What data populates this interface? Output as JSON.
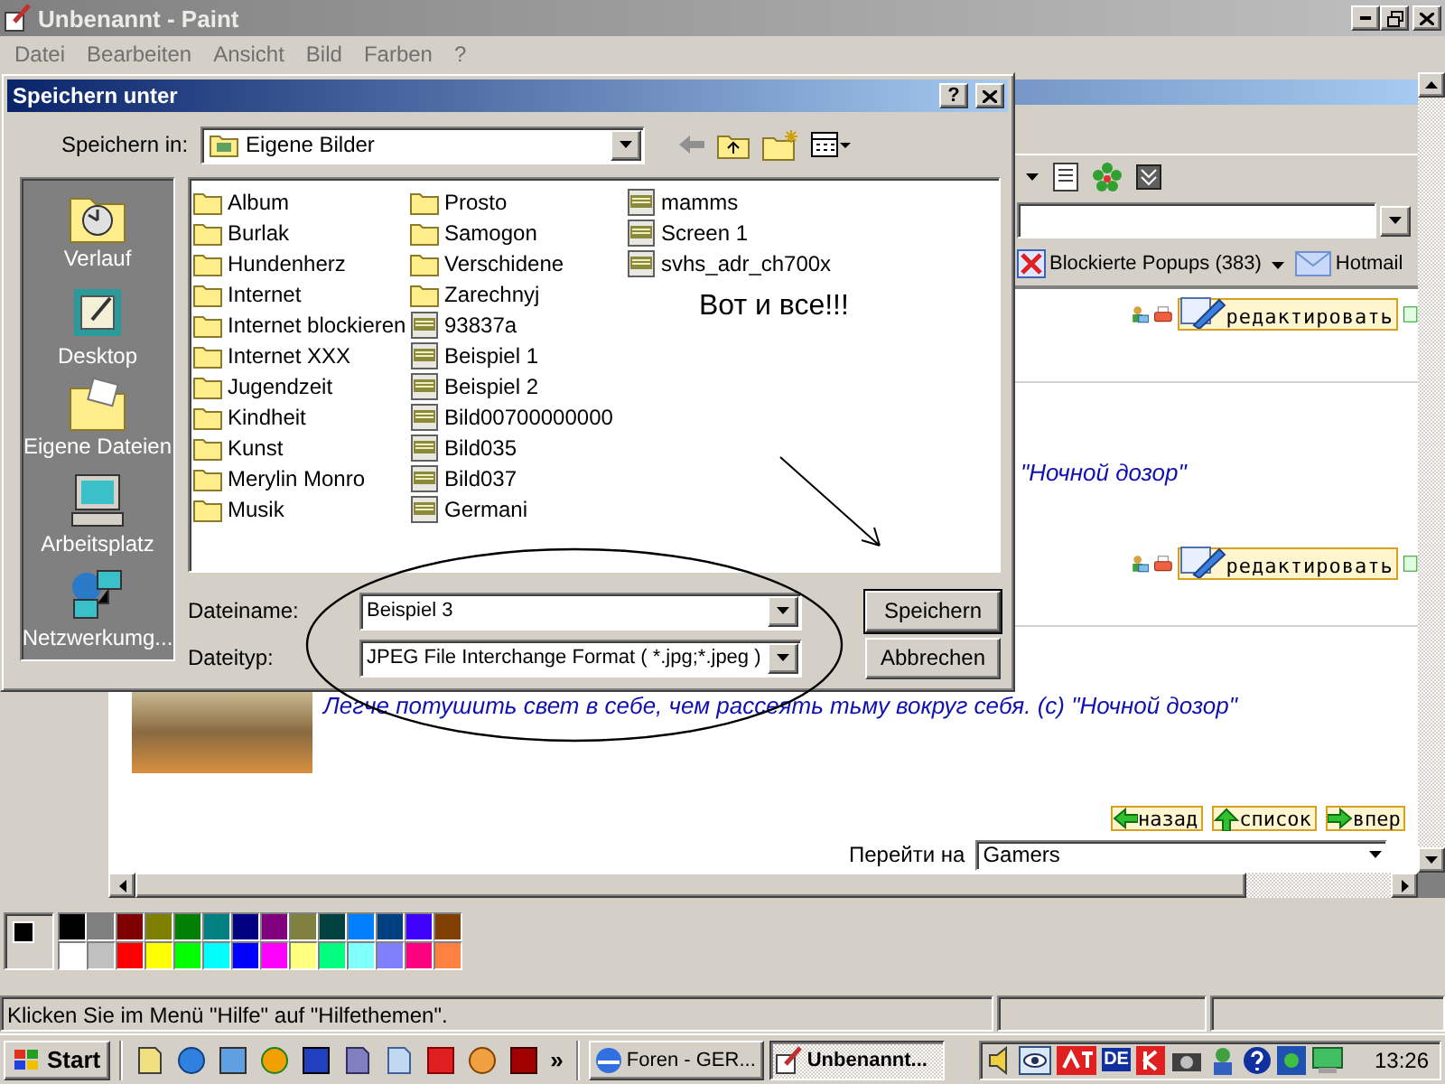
{
  "paint": {
    "title": "Unbenannt - Paint",
    "menu": [
      "Datei",
      "Bearbeiten",
      "Ansicht",
      "Bild",
      "Farben",
      "?"
    ]
  },
  "dialog": {
    "title": "Speichern unter",
    "help": "?",
    "save_in_label": "Speichern in:",
    "save_in_value": "Eigene Bilder",
    "places": [
      {
        "label": "Verlauf",
        "kind": "history"
      },
      {
        "label": "Desktop",
        "kind": "desktop"
      },
      {
        "label": "Eigene Dateien",
        "kind": "documents"
      },
      {
        "label": "Arbeitsplatz",
        "kind": "computer"
      },
      {
        "label": "Netzwerkumg...",
        "kind": "network"
      }
    ],
    "files": [
      {
        "name": "Album",
        "kind": "folder"
      },
      {
        "name": "Burlak",
        "kind": "folder"
      },
      {
        "name": "Hundenherz",
        "kind": "folder"
      },
      {
        "name": "Internet",
        "kind": "folder"
      },
      {
        "name": "Internet blockieren",
        "kind": "folder"
      },
      {
        "name": "Internet XXX",
        "kind": "folder"
      },
      {
        "name": "Jugendzeit",
        "kind": "folder"
      },
      {
        "name": "Kindheit",
        "kind": "folder"
      },
      {
        "name": "Kunst",
        "kind": "folder"
      },
      {
        "name": "Merylin Monro",
        "kind": "folder"
      },
      {
        "name": "Musik",
        "kind": "folder"
      },
      {
        "name": "Prosto",
        "kind": "folder"
      },
      {
        "name": "Samogon",
        "kind": "folder"
      },
      {
        "name": "Verschidene",
        "kind": "folder"
      },
      {
        "name": "Zarechnyj",
        "kind": "folder"
      },
      {
        "name": "93837a",
        "kind": "jpg"
      },
      {
        "name": "Beispiel 1",
        "kind": "jpg"
      },
      {
        "name": "Beispiel 2",
        "kind": "jpg"
      },
      {
        "name": "Bild00700000000",
        "kind": "jpg"
      },
      {
        "name": "Bild035",
        "kind": "jpg"
      },
      {
        "name": "Bild037",
        "kind": "jpg"
      },
      {
        "name": "Germani",
        "kind": "jpg"
      },
      {
        "name": "mamms",
        "kind": "jpg"
      },
      {
        "name": "Screen 1",
        "kind": "jpg"
      },
      {
        "name": "svhs_adr_ch700x",
        "kind": "jpg"
      }
    ],
    "filename_label": "Dateiname:",
    "filename": "Beispiel 3",
    "filetype_label": "Dateityp:",
    "filetype": "JPEG File Interchange Format ( *.jpg;*.jpeg )",
    "buttons": [
      "Speichern",
      "Abbrechen"
    ]
  },
  "annotation": {
    "text": "Вот и все!!!"
  },
  "browser": {
    "links": [
      {
        "label": "Blockierte Popups (383)",
        "kind": "blocked"
      },
      {
        "label": "Hotmail",
        "kind": "mail"
      }
    ],
    "edit_buttons": [
      "редактировать",
      "редактировать"
    ],
    "quote_tail": "\"Ночной дозор\"",
    "quote": "Легче потушить свет в себе, чем рассеять тьму вокруг себя. (с) \"Ночной дозор\"",
    "nav": [
      {
        "label": "назад",
        "kind": "back"
      },
      {
        "label": "список",
        "kind": "up"
      },
      {
        "label": "впер",
        "kind": "forward"
      }
    ],
    "goto_label": "Перейти на",
    "goto_value": "Gamers"
  },
  "palette": {
    "rows": [
      [
        {
          "color": "#000000"
        },
        {
          "color": "#808080"
        },
        {
          "color": "#800000"
        },
        {
          "color": "#808000"
        },
        {
          "color": "#008000"
        },
        {
          "color": "#008080"
        },
        {
          "color": "#000080"
        },
        {
          "color": "#800080"
        },
        {
          "color": "#808040"
        },
        {
          "color": "#004040"
        },
        {
          "color": "#0080ff"
        },
        {
          "color": "#004080"
        },
        {
          "color": "#4000ff"
        },
        {
          "color": "#804000"
        }
      ],
      [
        {
          "color": "#ffffff"
        },
        {
          "color": "#c0c0c0"
        },
        {
          "color": "#ff0000"
        },
        {
          "color": "#ffff00"
        },
        {
          "color": "#00ff00"
        },
        {
          "color": "#00ffff"
        },
        {
          "color": "#0000ff"
        },
        {
          "color": "#ff00ff"
        },
        {
          "color": "#ffff80"
        },
        {
          "color": "#00ff80"
        },
        {
          "color": "#80ffff"
        },
        {
          "color": "#8080ff"
        },
        {
          "color": "#ff0080"
        },
        {
          "color": "#ff8040"
        }
      ]
    ]
  },
  "status": "Klicken Sie im Menü \"Hilfe\" auf \"Hilfethemen\".",
  "taskbar": {
    "start": "Start",
    "overflow": "»",
    "tasks": [
      {
        "label": "Foren - GER...",
        "selected": false
      },
      {
        "label": "Unbenannt...",
        "selected": true
      }
    ],
    "language": "DE",
    "clock": "13:26"
  }
}
